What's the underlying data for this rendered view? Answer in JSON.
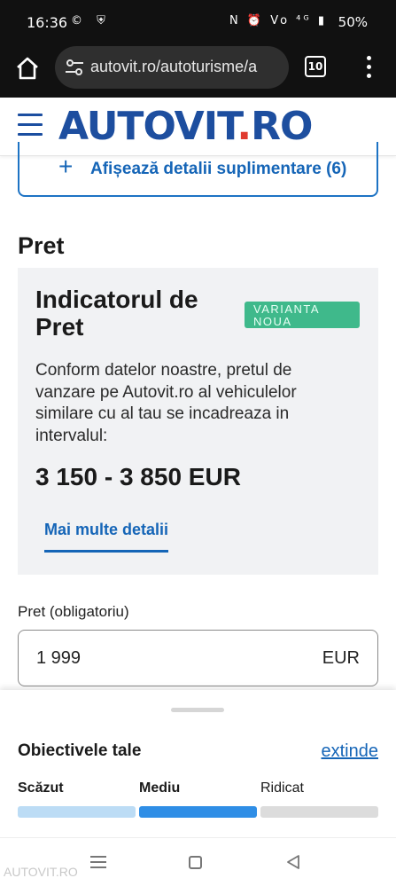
{
  "statusbar": {
    "time": "16:36",
    "left_icons": "© ⛨",
    "right_icons": "N ⏰ Vo ⁴ᴳ ▮",
    "battery": "50%"
  },
  "browser": {
    "url": "autovit.ro/autoturisme/a",
    "tab_count": "10"
  },
  "header": {
    "logo_part1": "AUTOVIT",
    "logo_dot": ".",
    "logo_part2": "RO",
    "logo_colors": {
      "blue": "#1d4e9f",
      "red": "#e03a2f"
    }
  },
  "expand_details": {
    "icon": "plus-icon",
    "label": "Afișează detalii suplimentare (6)"
  },
  "price_section": {
    "title": "Pret",
    "indicator": {
      "title": "Indicatorul de Pret",
      "badge": "VARIANTA NOUA",
      "description": "Conform datelor noastre, pretul de vanzare pe Autovit.ro al vehiculelor similare cu al tau se incadreaza in intervalul:",
      "range": "3 150 - 3 850 EUR",
      "more_link": "Mai multe detalii"
    },
    "field_label": "Pret (obligatoriu)",
    "value": "1 999",
    "currency": "EUR"
  },
  "goals": {
    "title": "Obiectivele tale",
    "expand": "extinde",
    "levels": [
      "Scăzut",
      "Mediu",
      "Ridicat"
    ],
    "fill_percent": 58,
    "colors": {
      "low": "#bcdcf5",
      "mid": "#2f8ee6",
      "high": "#1b6fcf",
      "empty": "#dcdcdc"
    }
  },
  "watermark": "AUTOVIT.RO"
}
